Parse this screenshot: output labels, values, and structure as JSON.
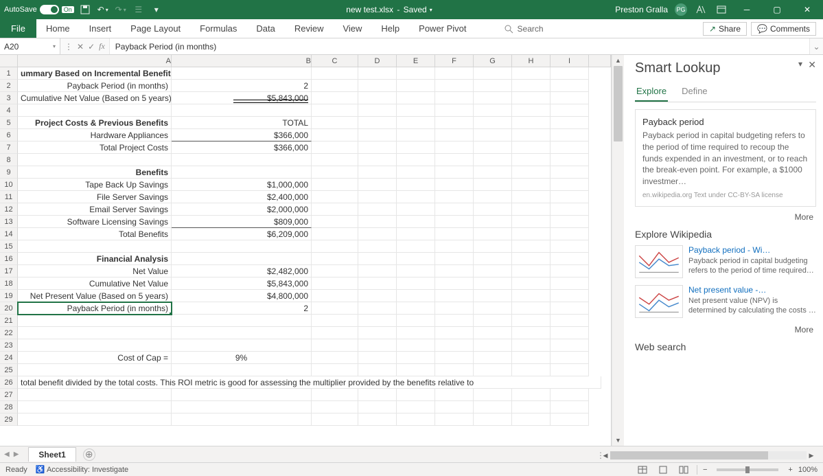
{
  "titlebar": {
    "autosave_label": "AutoSave",
    "autosave_state": "On",
    "doc_name": "new test.xlsx",
    "doc_status": "Saved",
    "user_name": "Preston Gralla",
    "user_initials": "PG"
  },
  "ribbon": {
    "tabs": [
      "File",
      "Home",
      "Insert",
      "Page Layout",
      "Formulas",
      "Data",
      "Review",
      "View",
      "Help",
      "Power Pivot"
    ],
    "search_placeholder": "Search",
    "share_label": "Share",
    "comments_label": "Comments"
  },
  "namebox": "A20",
  "formula": "Payback Period (in months)",
  "columns": [
    "A",
    "B",
    "C",
    "D",
    "E",
    "F",
    "G",
    "H",
    "I"
  ],
  "rows": [
    {
      "n": 1,
      "A": "ummary Based on Incremental Benefits",
      "A_bold": true,
      "A_left": true
    },
    {
      "n": 2,
      "A": "Payback Period (in months)",
      "B": "2"
    },
    {
      "n": 3,
      "A": "Cumulative Net Value  (Based on 5 years)",
      "A_left": true,
      "B": "$5,843,000",
      "B_dblunder": true
    },
    {
      "n": 4
    },
    {
      "n": 5,
      "A": "Project Costs & Previous Benefits",
      "A_bold": true,
      "B": "TOTAL"
    },
    {
      "n": 6,
      "A": "Hardware Appliances",
      "B": "$366,000",
      "B_under": true
    },
    {
      "n": 7,
      "A": "Total Project Costs",
      "B": "$366,000"
    },
    {
      "n": 8
    },
    {
      "n": 9,
      "A": "Benefits",
      "A_bold": true
    },
    {
      "n": 10,
      "A": "Tape Back Up Savings",
      "B": "$1,000,000"
    },
    {
      "n": 11,
      "A": "File Server Savings",
      "B": "$2,400,000"
    },
    {
      "n": 12,
      "A": "Email Server Savings",
      "B": "$2,000,000"
    },
    {
      "n": 13,
      "A": "Software Licensing Savings",
      "B": "$809,000",
      "B_under": true
    },
    {
      "n": 14,
      "A": "Total Benefits",
      "B": "$6,209,000"
    },
    {
      "n": 15
    },
    {
      "n": 16,
      "A": "Financial Analysis",
      "A_bold": true
    },
    {
      "n": 17,
      "A": "Net Value",
      "B": "$2,482,000"
    },
    {
      "n": 18,
      "A": "Cumulative Net Value",
      "B": "$5,843,000"
    },
    {
      "n": 19,
      "A": "Net Present Value (Based on 5 years)",
      "B": "$4,800,000"
    },
    {
      "n": 20,
      "A": "Payback Period (in months)",
      "B": "2",
      "selected": true
    },
    {
      "n": 21
    },
    {
      "n": 22
    },
    {
      "n": 23
    },
    {
      "n": 24,
      "A": "Cost of Cap =",
      "B": "9%",
      "B_center": true
    },
    {
      "n": 25
    },
    {
      "n": 26,
      "overflow": "total benefit divided by the total costs.  This ROI metric is good for assessing the multiplier provided by the benefits relative to"
    },
    {
      "n": 27
    },
    {
      "n": 28
    },
    {
      "n": 29
    }
  ],
  "smart_lookup": {
    "title": "Smart Lookup",
    "tabs": [
      "Explore",
      "Define"
    ],
    "active_tab": 0,
    "card": {
      "title": "Payback period",
      "body": "Payback period in capital budgeting refers to the period of time required to recoup the funds expended in an investment, or to reach the break-even point. For example, a $1000 investmer…",
      "source": "en.wikipedia.org   Text under CC-BY-SA license"
    },
    "more_label": "More",
    "wiki_title": "Explore Wikipedia",
    "wiki_items": [
      {
        "title": "Payback period - Wi…",
        "body": "Payback period in capital budgeting refers to the period of time required…"
      },
      {
        "title": "Net present value -…",
        "body": "Net present value (NPV) is determined by calculating the costs    …"
      }
    ],
    "web_search_title": "Web search"
  },
  "sheet": {
    "active": "Sheet1"
  },
  "status": {
    "ready": "Ready",
    "accessibility": "Accessibility: Investigate",
    "zoom": "100%"
  }
}
